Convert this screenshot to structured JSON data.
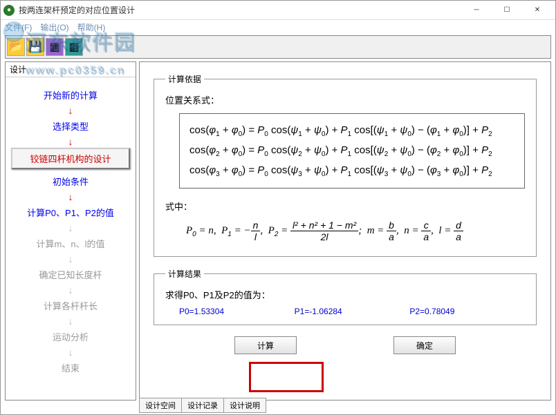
{
  "window": {
    "title": "按两连架杆预定的对应位置设计"
  },
  "menu": {
    "file": "文件(F)",
    "output": "输出(O)",
    "help": "帮助(H)"
  },
  "watermark": {
    "text": "河东软件园",
    "url": "www.pc0359.cn"
  },
  "sidebar": {
    "tab": "设计",
    "steps": [
      "开始新的计算",
      "选择类型",
      "铰链四杆机构的设计",
      "初始条件",
      "计算P0、P1、P2的值",
      "计算m、n、l的值",
      "确定已知长度杆",
      "计算各杆杆长",
      "运动分析",
      "结束"
    ]
  },
  "basis": {
    "groupTitle": "计算依据",
    "relationLabel": "位置关系式：",
    "whereLabel": "式中："
  },
  "result": {
    "groupTitle": "计算结果",
    "label": "求得P0、P1及P2的值为：",
    "p0": "P0=1.53304",
    "p1": "P1=-1.06284",
    "p2": "P2=0.78049"
  },
  "buttons": {
    "calc": "计算",
    "ok": "确定"
  },
  "bottomTabs": {
    "t1": "设计空间",
    "t2": "设计记录",
    "t3": "设计说明"
  }
}
